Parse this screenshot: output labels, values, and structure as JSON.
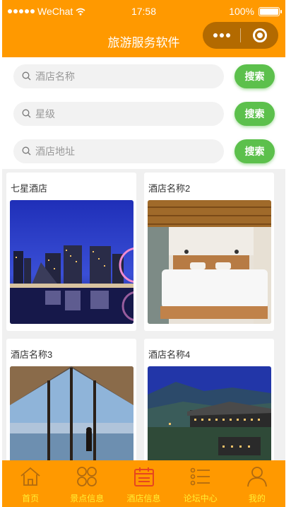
{
  "status_bar": {
    "carrier": "WeChat",
    "time": "17:58",
    "battery": "100%",
    "battery_level": 1.0
  },
  "navbar": {
    "title": "旅游服务软件"
  },
  "search": {
    "rows": [
      {
        "placeholder": "酒店名称",
        "button": "搜索"
      },
      {
        "placeholder": "星级",
        "button": "搜索"
      },
      {
        "placeholder": "酒店地址",
        "button": "搜索"
      }
    ]
  },
  "hotels": [
    {
      "name": "七星酒店",
      "image": "city-night-skyline"
    },
    {
      "name": "酒店名称2",
      "image": "wooden-bedroom"
    },
    {
      "name": "酒店名称3",
      "image": "window-lake-view"
    },
    {
      "name": "酒店名称4",
      "image": "mountain-resort"
    }
  ],
  "tabbar": {
    "items": [
      {
        "label": "首页",
        "icon": "home-icon"
      },
      {
        "label": "景点信息",
        "icon": "grid-icon"
      },
      {
        "label": "酒店信息",
        "icon": "calendar-icon",
        "active": true
      },
      {
        "label": "论坛中心",
        "icon": "list-icon"
      },
      {
        "label": "我的",
        "icon": "user-icon"
      }
    ]
  },
  "colors": {
    "theme": "#ff9900",
    "search_button": "#5cc04c",
    "tab_label": "#ffee33",
    "active_icon": "#e6451f"
  }
}
